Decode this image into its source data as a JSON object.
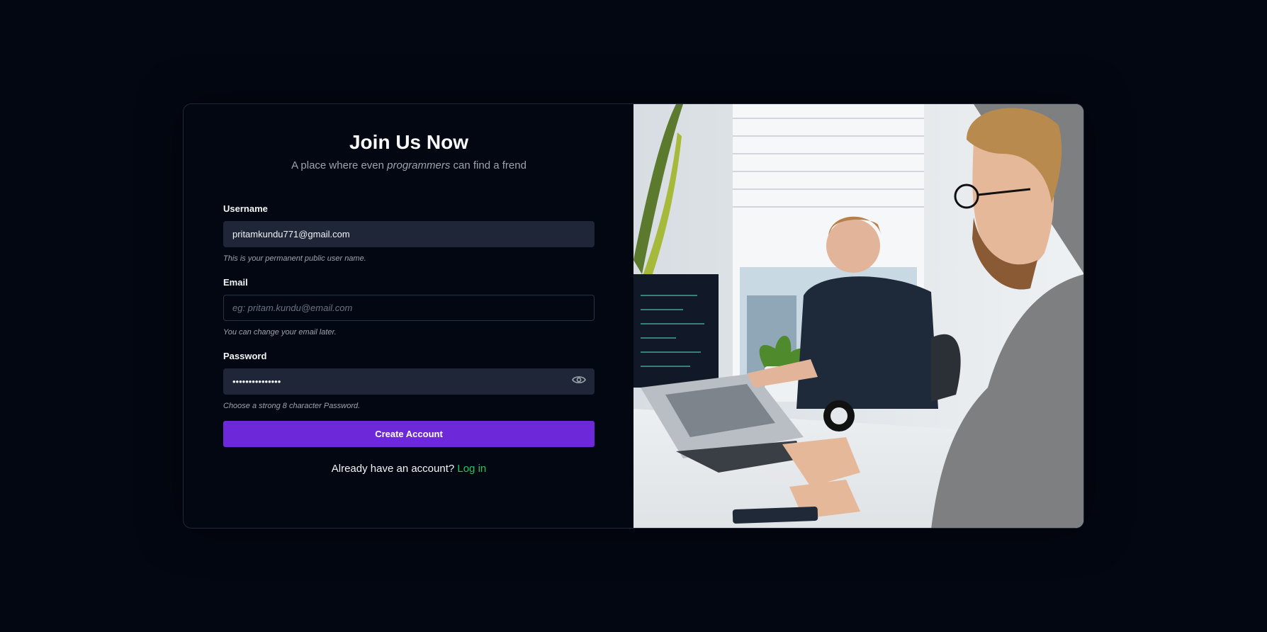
{
  "form": {
    "title": "Join Us Now",
    "subtitle_before": "A place where even ",
    "subtitle_emphasis": "programmers",
    "subtitle_after": " can find a frend",
    "username": {
      "label": "Username",
      "value": "pritamkundu771@gmail.com",
      "hint": "This is your permanent public user name."
    },
    "email": {
      "label": "Email",
      "value": "",
      "placeholder": "eg: pritam.kundu@email.com",
      "hint": "You can change your email later."
    },
    "password": {
      "label": "Password",
      "value": "•••••••••••••••",
      "hint": "Choose a strong 8 character Password."
    },
    "submit_label": "Create Account",
    "login_prompt": "Already have an account? ",
    "login_link": "Log in"
  },
  "colors": {
    "background": "#030712",
    "accent": "#6d28d9",
    "link": "#22c55e",
    "input_fill": "#1e2638"
  },
  "icons": {
    "password_toggle": "eye-icon"
  }
}
